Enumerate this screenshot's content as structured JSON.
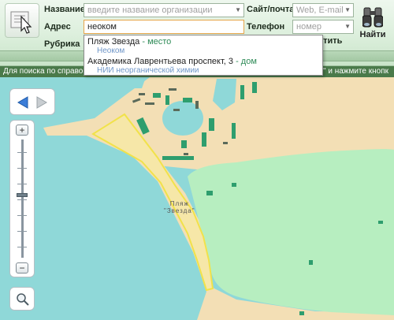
{
  "search": {
    "name_label": "Название",
    "name_placeholder": "введите название организации",
    "site_label": "Сайт/почта",
    "site_placeholder": "Web, E-mail",
    "address_label": "Адрес",
    "address_value": "неоком",
    "phone_label": "Телефон",
    "phone_placeholder": "номер",
    "rubric_label": "Рубрика",
    "find_label": "Найти",
    "clear_label": "стить"
  },
  "hint": {
    "left": "Для поиска по справо",
    "right": "\" и нажмите кнопк"
  },
  "suggestions": [
    {
      "title": "Пляж Звезда",
      "sep": " - ",
      "type": "место",
      "sub": "Неоком"
    },
    {
      "title": "Академика Лаврентьева проспект, 3",
      "sep": " - ",
      "type": "дом",
      "sub": "НИИ неорганической химии"
    }
  ],
  "map": {
    "label_line1": "Пляж",
    "label_line2": "\"Звезда\"",
    "colors": {
      "water": "#8fd8d8",
      "sand": "#f3dfb5",
      "forest": "#b7eec0",
      "building": "#2e9e6e",
      "highlight": "#f1e24a"
    }
  },
  "icons": {
    "logo": "directory-pointer-icon",
    "find": "binoculars-icon",
    "back": "arrow-left-icon",
    "forward": "arrow-right-icon",
    "zoom_in": "plus-icon",
    "zoom_out": "minus-icon",
    "loupe": "magnifier-icon"
  }
}
